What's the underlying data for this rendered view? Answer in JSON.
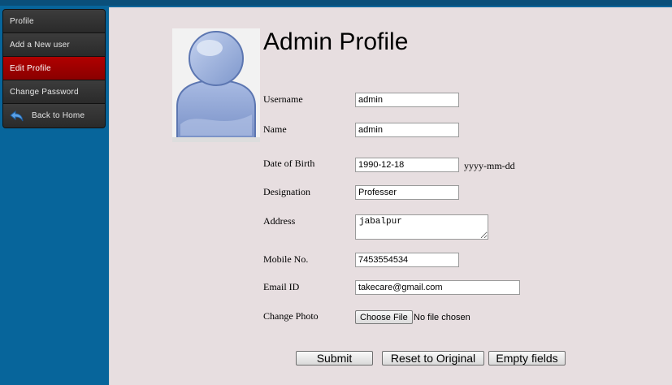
{
  "sidebar": {
    "items": [
      {
        "label": "Profile",
        "icon": "none"
      },
      {
        "label": "Add a New user",
        "icon": "none"
      },
      {
        "label": "Edit Profile",
        "icon": "none",
        "active": true
      },
      {
        "label": "Change Password",
        "icon": "none"
      },
      {
        "label": "Back to Home",
        "icon": "back-arrow-icon"
      }
    ]
  },
  "main": {
    "title": "Admin Profile",
    "avatar_icon": "user-silhouette-icon",
    "fields": {
      "username": {
        "label": "Username",
        "value": "admin"
      },
      "name": {
        "label": "Name",
        "value": "admin"
      },
      "dob": {
        "label": "Date of Birth",
        "value": "1990-12-18",
        "hint": "yyyy-mm-dd"
      },
      "designation": {
        "label": "Designation",
        "value": "Professer"
      },
      "address": {
        "label": "Address",
        "value": "jabalpur"
      },
      "mobile": {
        "label": "Mobile No.",
        "value": "7453554534"
      },
      "email": {
        "label": "Email ID",
        "value": "takecare@gmail.com"
      },
      "photo": {
        "label": "Change Photo",
        "button": "Choose File",
        "status": "No file chosen"
      }
    },
    "buttons": {
      "submit": "Submit",
      "reset": "Reset to Original",
      "empty": "Empty fields"
    }
  },
  "colors": {
    "background": "#07659b",
    "content": "#e7dee0",
    "active_nav": "#a00000",
    "nav": "#333333"
  }
}
